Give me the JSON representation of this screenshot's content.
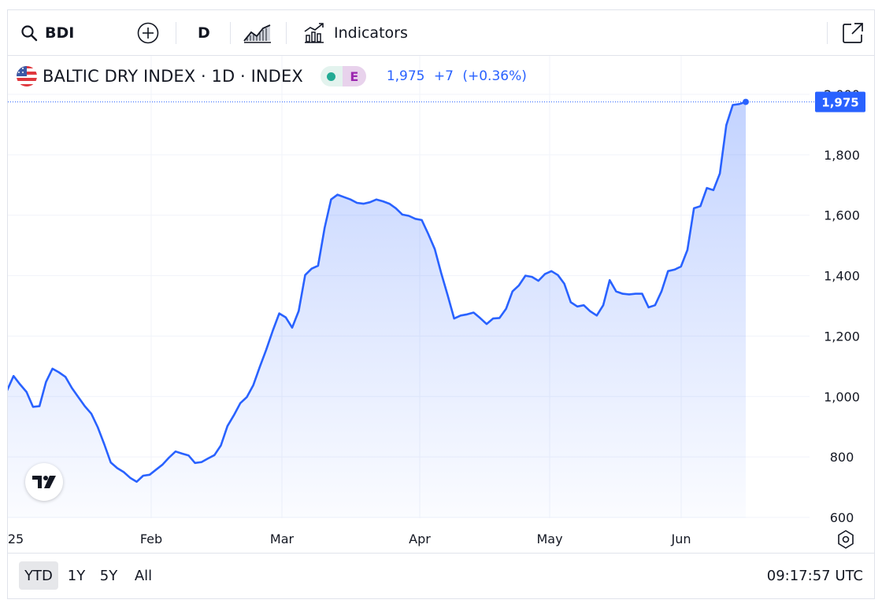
{
  "toolbar": {
    "symbol": "BDI",
    "interval": "D",
    "indicators_label": "Indicators"
  },
  "legend": {
    "title": "BALTIC DRY INDEX · 1D · INDEX",
    "badge_letter": "E",
    "last": "1,975",
    "change": "+7",
    "change_pct": "(+0.36%)"
  },
  "price_label": "1,975",
  "ranges": [
    "YTD",
    "1Y",
    "5Y",
    "All"
  ],
  "selected_range": "YTD",
  "clock": "09:17:57 UTC",
  "colors": {
    "line": "#2962ff",
    "grid": "#f0f3fa",
    "text": "#131722",
    "badge_green": "#22ab94",
    "badge_purple": "#9c27b0"
  },
  "chart_data": {
    "type": "area",
    "title": "BALTIC DRY INDEX · 1D · INDEX",
    "x_ticks": [
      "25",
      "Feb",
      "Mar",
      "Apr",
      "May",
      "Jun"
    ],
    "y_ticks": [
      600,
      800,
      1000,
      1200,
      1400,
      1600,
      1800,
      2000
    ],
    "ylim": [
      600,
      2000
    ],
    "grid": true,
    "last_value": 1975,
    "series": [
      {
        "values": [
          1020,
          1068,
          1040,
          1015,
          966,
          968,
          1048,
          1092,
          1080,
          1065,
          1028,
          998,
          968,
          943,
          898,
          842,
          782,
          763,
          750,
          731,
          718,
          738,
          741,
          758,
          775,
          798,
          818,
          811,
          805,
          780,
          783,
          795,
          806,
          838,
          902,
          938,
          978,
          998,
          1038,
          1098,
          1155,
          1218,
          1275,
          1262,
          1228,
          1283,
          1402,
          1423,
          1433,
          1558,
          1652,
          1668,
          1660,
          1652,
          1641,
          1638,
          1643,
          1652,
          1646,
          1638,
          1623,
          1602,
          1598,
          1588,
          1584,
          1538,
          1488,
          1408,
          1335,
          1258,
          1268,
          1272,
          1278,
          1260,
          1240,
          1258,
          1260,
          1290,
          1348,
          1368,
          1400,
          1396,
          1383,
          1405,
          1415,
          1402,
          1373,
          1312,
          1298,
          1302,
          1282,
          1268,
          1302,
          1385,
          1348,
          1340,
          1338,
          1340,
          1340,
          1295,
          1302,
          1348,
          1415,
          1420,
          1430,
          1485,
          1623,
          1630,
          1690,
          1683,
          1738,
          1898,
          1965,
          1968,
          1975
        ]
      }
    ]
  }
}
